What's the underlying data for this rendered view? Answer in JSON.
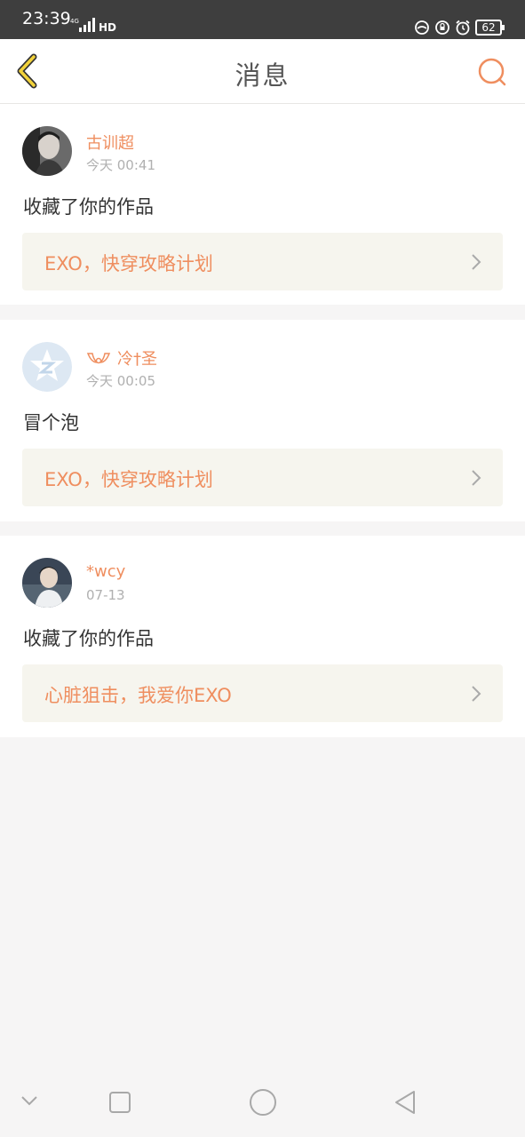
{
  "status": {
    "time": "23:39",
    "network": "4G HD",
    "battery": "62"
  },
  "header": {
    "title": "消息"
  },
  "messages": [
    {
      "user": "古训超",
      "time": "今天 00:41",
      "text": "收藏了你的作品",
      "work": "EXO，快穿攻略计划"
    },
    {
      "user": "冷†圣",
      "time": "今天 00:05",
      "text": "冒个泡",
      "work": "EXO，快穿攻略计划"
    },
    {
      "user": "*wcy",
      "time": "07-13",
      "text": "收藏了你的作品",
      "work": "心脏狙击，我爱你EXO"
    }
  ],
  "colors": {
    "accent": "#ef8e5f",
    "back_arrow": "#f2d23a",
    "card_bg": "#f6f5ee",
    "page_bg": "#f6f5f5"
  },
  "icons": [
    "back-arrow-icon",
    "search-icon",
    "chevron-right-icon",
    "nav-back-icon",
    "nav-home-icon",
    "nav-recents-icon",
    "nav-collapse-icon"
  ]
}
